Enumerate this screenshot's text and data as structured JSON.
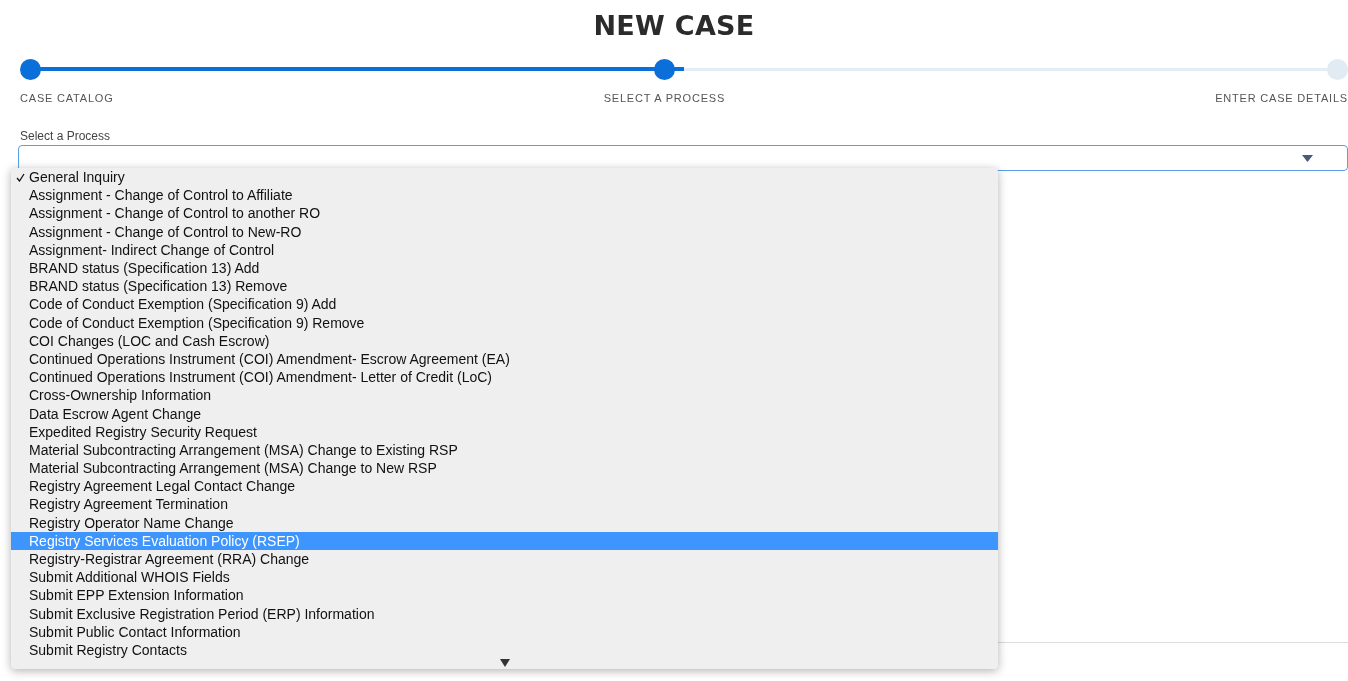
{
  "title": "NEW CASE",
  "progress": {
    "level": 0.5
  },
  "steps": [
    {
      "label": "CASE CATALOG",
      "done": true
    },
    {
      "label": "SELECT A PROCESS",
      "done": true
    },
    {
      "label": "ENTER CASE DETAILS",
      "done": false
    }
  ],
  "process_field": {
    "label": "Select a Process",
    "expanded": true
  },
  "options": [
    {
      "label": "General Inquiry",
      "checked": true,
      "selected": false
    },
    {
      "label": "Assignment - Change of Control to Affiliate",
      "checked": false,
      "selected": false
    },
    {
      "label": "Assignment - Change of Control to another RO",
      "checked": false,
      "selected": false
    },
    {
      "label": "Assignment - Change of Control to New-RO",
      "checked": false,
      "selected": false
    },
    {
      "label": "Assignment- Indirect Change of Control",
      "checked": false,
      "selected": false
    },
    {
      "label": "BRAND status (Specification 13) Add",
      "checked": false,
      "selected": false
    },
    {
      "label": "BRAND status (Specification 13) Remove",
      "checked": false,
      "selected": false
    },
    {
      "label": "Code of Conduct Exemption (Specification 9) Add",
      "checked": false,
      "selected": false
    },
    {
      "label": "Code of Conduct Exemption (Specification 9) Remove",
      "checked": false,
      "selected": false
    },
    {
      "label": "COI Changes (LOC and Cash Escrow)",
      "checked": false,
      "selected": false
    },
    {
      "label": "Continued Operations Instrument (COI) Amendment- Escrow Agreement (EA)",
      "checked": false,
      "selected": false
    },
    {
      "label": "Continued Operations Instrument (COI) Amendment- Letter of Credit (LoC)",
      "checked": false,
      "selected": false
    },
    {
      "label": "Cross-Ownership Information",
      "checked": false,
      "selected": false
    },
    {
      "label": "Data Escrow Agent Change",
      "checked": false,
      "selected": false
    },
    {
      "label": "Expedited Registry Security Request",
      "checked": false,
      "selected": false
    },
    {
      "label": "Material Subcontracting Arrangement (MSA) Change to Existing RSP",
      "checked": false,
      "selected": false
    },
    {
      "label": "Material Subcontracting Arrangement (MSA) Change to New RSP",
      "checked": false,
      "selected": false
    },
    {
      "label": "Registry Agreement Legal Contact Change",
      "checked": false,
      "selected": false
    },
    {
      "label": "Registry Agreement Termination",
      "checked": false,
      "selected": false
    },
    {
      "label": "Registry Operator Name Change",
      "checked": false,
      "selected": false
    },
    {
      "label": "Registry Services Evaluation Policy (RSEP)",
      "checked": false,
      "selected": true
    },
    {
      "label": "Registry-Registrar Agreement (RRA) Change",
      "checked": false,
      "selected": false
    },
    {
      "label": "Submit Additional WHOIS Fields",
      "checked": false,
      "selected": false
    },
    {
      "label": "Submit EPP Extension Information",
      "checked": false,
      "selected": false
    },
    {
      "label": "Submit Exclusive Registration Period (ERP) Information",
      "checked": false,
      "selected": false
    },
    {
      "label": "Submit Public Contact Information",
      "checked": false,
      "selected": false
    },
    {
      "label": "Submit Registry Contacts",
      "checked": false,
      "selected": false
    }
  ]
}
